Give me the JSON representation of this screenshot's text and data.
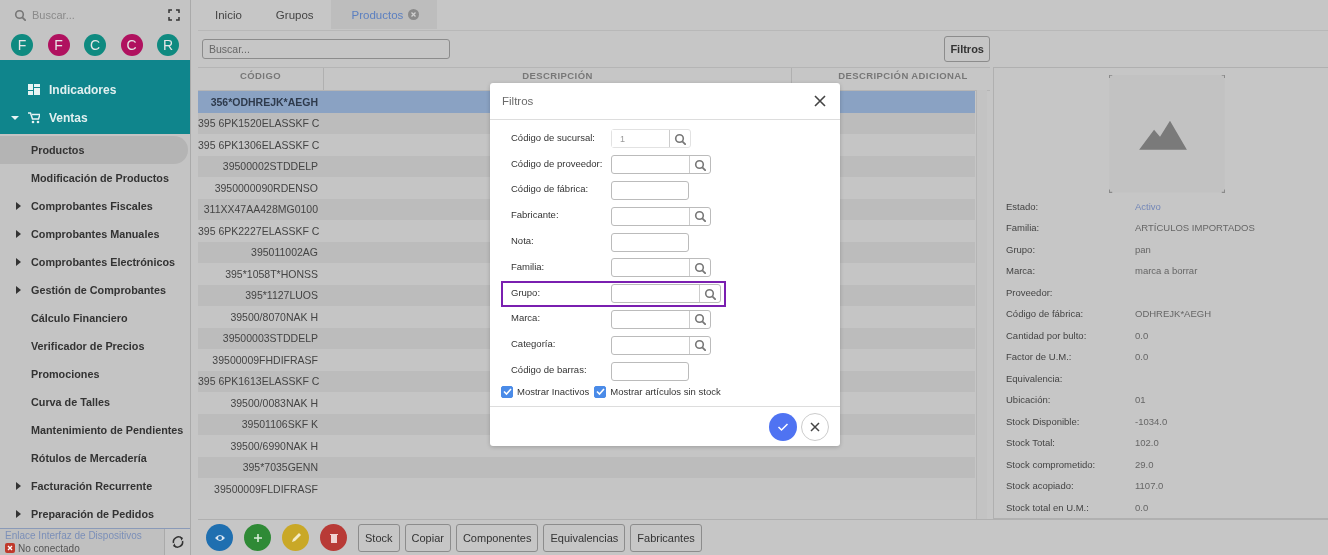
{
  "sidebar": {
    "search": {
      "placeholder": "Buscar..."
    },
    "avatars": [
      {
        "letter": "F",
        "color": "#0f8a80"
      },
      {
        "letter": "F",
        "color": "#b0115f"
      },
      {
        "letter": "C",
        "color": "#0f8a80"
      },
      {
        "letter": "C",
        "color": "#b0115f"
      },
      {
        "letter": "R",
        "color": "#0f8a80"
      }
    ],
    "sections": [
      {
        "label": "Indicadores",
        "expanded": false
      },
      {
        "label": "Ventas",
        "expanded": true
      }
    ],
    "items": [
      {
        "label": "Productos",
        "kind": "leaf",
        "selected": true
      },
      {
        "label": "Modificación de Productos",
        "kind": "leaf",
        "selected": false
      },
      {
        "label": "Comprobantes Fiscales",
        "kind": "submenu",
        "selected": false
      },
      {
        "label": "Comprobantes Manuales",
        "kind": "submenu",
        "selected": false
      },
      {
        "label": "Comprobantes Electrónicos",
        "kind": "submenu",
        "selected": false
      },
      {
        "label": "Gestión de Comprobantes",
        "kind": "submenu",
        "selected": false
      },
      {
        "label": "Cálculo Financiero",
        "kind": "leaf",
        "selected": false
      },
      {
        "label": "Verificador de Precios",
        "kind": "leaf",
        "selected": false
      },
      {
        "label": "Promociones",
        "kind": "leaf",
        "selected": false
      },
      {
        "label": "Curva de Talles",
        "kind": "leaf",
        "selected": false
      },
      {
        "label": "Mantenimiento de Pendientes",
        "kind": "leaf",
        "selected": false
      },
      {
        "label": "Rótulos de Mercadería",
        "kind": "leaf",
        "selected": false
      },
      {
        "label": "Facturación Recurrente",
        "kind": "submenu",
        "selected": false
      },
      {
        "label": "Preparación de Pedidos",
        "kind": "submenu",
        "selected": false
      }
    ],
    "device_link": "Enlace Interfaz de Dispositivos",
    "device_status": "No conectado"
  },
  "tabs": [
    {
      "label": "Inicio",
      "selected": false,
      "closable": false
    },
    {
      "label": "Grupos",
      "selected": false,
      "closable": false
    },
    {
      "label": "Productos",
      "selected": true,
      "closable": true
    }
  ],
  "search": {
    "placeholder": "Buscar..."
  },
  "filters_button": "Filtros",
  "table": {
    "columns": [
      "CÓDIGO",
      "DESCRIPCIÓN",
      "DESCRIPCIÓN ADICIONAL"
    ],
    "rows": [
      {
        "code": "356*ODHREJK*AEGH",
        "selected": true
      },
      {
        "code": "395 6PK1520ELASSKF C",
        "selected": false
      },
      {
        "code": "395 6PK1306ELASSKF C",
        "selected": false
      },
      {
        "code": "39500002STDDELP",
        "selected": false
      },
      {
        "code": "3950000090RDENSO",
        "selected": false
      },
      {
        "code": "311XX47AA428MG0100",
        "selected": false
      },
      {
        "code": "395 6PK2227ELASSKF C",
        "selected": false
      },
      {
        "code": "395011002AG",
        "selected": false
      },
      {
        "code": "395*1058T*HONSS",
        "selected": false
      },
      {
        "code": "395*1127LUOS",
        "selected": false
      },
      {
        "code": "39500/8070NAK H",
        "selected": false
      },
      {
        "code": "39500003STDDELP",
        "selected": false
      },
      {
        "code": "39500009FHDIFRASF",
        "selected": false
      },
      {
        "code": "395 6PK1613ELASSKF C",
        "selected": false
      },
      {
        "code": "39500/0083NAK H",
        "selected": false
      },
      {
        "code": "39501106SKF K",
        "selected": false
      },
      {
        "code": "39500/6990NAK H",
        "selected": false
      },
      {
        "code": "395*7035GENN",
        "selected": false
      },
      {
        "code": "39500009FLDIFRASF",
        "selected": false
      }
    ]
  },
  "details": [
    {
      "label": "Estado:",
      "value": "Activo",
      "kind": "status"
    },
    {
      "label": "Familia:",
      "value": "ARTÍCULOS IMPORTADOS",
      "kind": "text"
    },
    {
      "label": "Grupo:",
      "value": "pan",
      "kind": "text"
    },
    {
      "label": "Marca:",
      "value": "marca a borrar",
      "kind": "text"
    },
    {
      "label": "Proveedor:",
      "kind": "text"
    },
    {
      "label": "Código de fábrica:",
      "value": "ODHREJK*AEGH",
      "kind": "text"
    },
    {
      "label": "Cantidad por bulto:",
      "value": "0.0",
      "kind": "text"
    },
    {
      "label": "Factor de U.M.:",
      "value": "0.0",
      "kind": "text"
    },
    {
      "label": "Equivalencia:",
      "kind": "text"
    },
    {
      "label": "Ubicación:",
      "value": "01",
      "kind": "text"
    },
    {
      "label": "Stock Disponible:",
      "value": "-1034.0",
      "kind": "text"
    },
    {
      "label": "Stock Total:",
      "value": "102.0",
      "kind": "text"
    },
    {
      "label": "Stock comprometido:",
      "value": "29.0",
      "kind": "text"
    },
    {
      "label": "Stock acopiado:",
      "value": "1107.0",
      "kind": "text"
    },
    {
      "label": "Stock total en U.M.:",
      "value": "0.0",
      "kind": "text"
    }
  ],
  "toolbar": {
    "icon_buttons": [
      {
        "kind": "view",
        "color": "#1f6fb0"
      },
      {
        "kind": "add",
        "color": "#2f8a36"
      },
      {
        "kind": "edit",
        "color": "#c9a827"
      },
      {
        "kind": "delete",
        "color": "#b83a36"
      }
    ],
    "buttons": [
      "Stock",
      "Copiar",
      "Componentes",
      "Equivalencias",
      "Fabricantes"
    ]
  },
  "dialog": {
    "title": "Filtros",
    "fields": [
      {
        "label": "Código de sucursal:",
        "kind": "lookup",
        "value": "1",
        "disabled": true,
        "highlighted": false
      },
      {
        "label": "Código de proveedor:",
        "kind": "lookup",
        "disabled": false,
        "highlighted": false
      },
      {
        "label": "Código de fábrica:",
        "kind": "text",
        "disabled": false,
        "highlighted": false
      },
      {
        "label": "Fabricante:",
        "kind": "lookup",
        "disabled": false,
        "highlighted": false
      },
      {
        "label": "Nota:",
        "kind": "text",
        "disabled": false,
        "highlighted": false
      },
      {
        "label": "Familia:",
        "kind": "lookup",
        "disabled": false,
        "highlighted": false
      },
      {
        "label": "Grupo:",
        "kind": "lookup",
        "disabled": false,
        "highlighted": true
      },
      {
        "label": "Marca:",
        "kind": "lookup",
        "disabled": false,
        "highlighted": false
      },
      {
        "label": "Categoría:",
        "kind": "lookup",
        "disabled": false,
        "highlighted": false
      },
      {
        "label": "Código de barras:",
        "kind": "text",
        "disabled": false,
        "highlighted": false
      }
    ],
    "checkboxes": [
      {
        "label": "Mostrar Inactivos",
        "checked": true
      },
      {
        "label": "Mostrar artículos sin stock",
        "checked": true
      }
    ]
  }
}
